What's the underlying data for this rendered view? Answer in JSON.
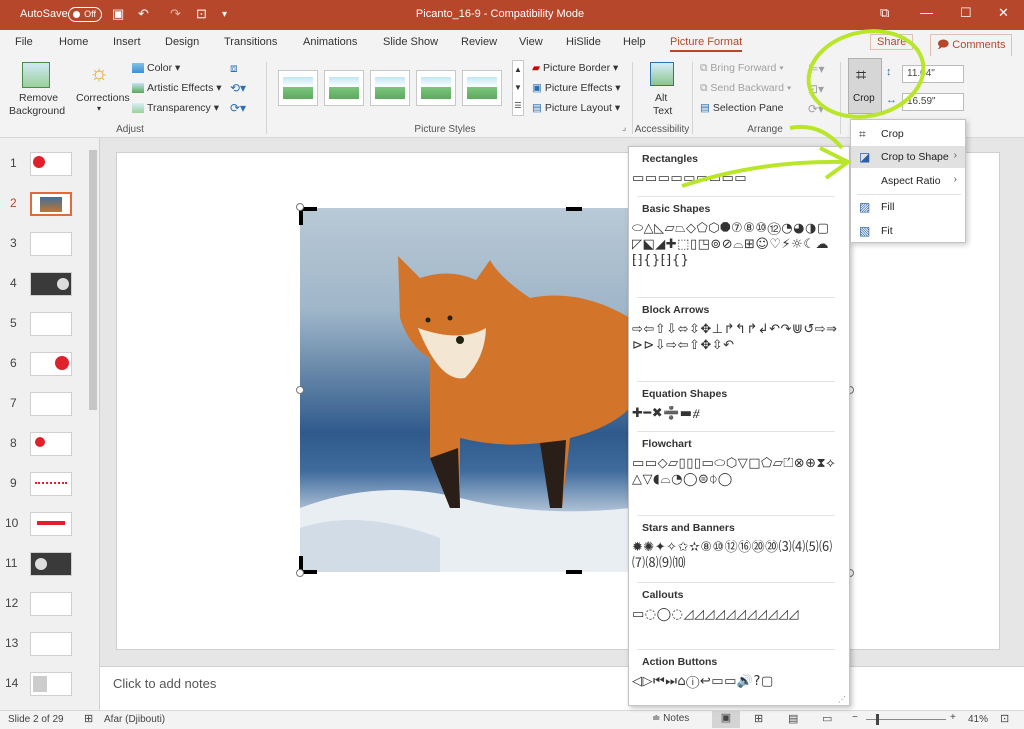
{
  "titlebar": {
    "autosave_label": "AutoSave",
    "autosave_state": "Off",
    "title": "Picanto_16-9  -  Compatibility Mode",
    "icons": [
      "save-icon",
      "undo-icon",
      "redo-icon",
      "present-icon",
      "customize-icon"
    ],
    "window_controls": [
      "restore-icon",
      "minimize-icon",
      "maximize-icon",
      "close-icon"
    ]
  },
  "menu": {
    "items": [
      "File",
      "Home",
      "Insert",
      "Design",
      "Transitions",
      "Animations",
      "Slide Show",
      "Review",
      "View",
      "HiSlide",
      "Help",
      "Picture Format"
    ],
    "active": "Picture Format",
    "share": "Share",
    "comments": "Comments"
  },
  "ribbon": {
    "remove_bg_line1": "Remove",
    "remove_bg_line2": "Background",
    "corrections": "Corrections",
    "color": "Color",
    "artistic_effects": "Artistic Effects",
    "transparency": "Transparency",
    "adjust_label": "Adjust",
    "picture_styles_label": "Picture Styles",
    "picture_border": "Picture Border",
    "picture_effects": "Picture Effects",
    "picture_layout": "Picture Layout",
    "alt_text_line1": "Alt",
    "alt_text_line2": "Text",
    "accessibility_label": "Accessibility",
    "bring_forward": "Bring Forward",
    "send_backward": "Send Backward",
    "selection_pane": "Selection Pane",
    "arrange_label": "Arrange",
    "crop": "Crop",
    "height": "11.04\"",
    "width": "16.59\""
  },
  "slides": {
    "numbers": [
      "1",
      "2",
      "3",
      "4",
      "5",
      "6",
      "7",
      "8",
      "9",
      "10",
      "11",
      "12",
      "13",
      "14"
    ],
    "selected": "2"
  },
  "notes_placeholder": "Click to add notes",
  "status": {
    "slide": "Slide 2 of 29",
    "language": "Afar (Djibouti)",
    "notes": "Notes",
    "zoom": "41%"
  },
  "shapes_gallery": {
    "sections": [
      {
        "title": "Rectangles",
        "glyphs": "▭▭▭▭▭▭▭▭▭"
      },
      {
        "title": "Basic Shapes",
        "glyphs": "⬭△◺▱⏢◇⬠⬡⯃⑦⑧⑩⑫◔◕◑▢◸⬕◢✚⬚▯◳⊚⊘⌓⊞☺♡⚡☼☾☁⁅⁆{}⁅⁆{}"
      },
      {
        "title": "Block Arrows",
        "glyphs": "⇨⇦⇧⇩⬄⇳✥⊥↱↰↱↲↶↷⋓↺⇨⇒⊳⊳⇩⇨⇦⇧✥⇳↶"
      },
      {
        "title": "Equation Shapes",
        "glyphs": "✚━✖➗▬⧣"
      },
      {
        "title": "Flowchart",
        "glyphs": "▭▭◇▱▯▯▯▭⬭⬡▽□⬠▱⏍⊗⊕⧗⟡△▽◖⌓◔◯⊜⏀◯"
      },
      {
        "title": "Stars and Banners",
        "glyphs": "✹✺✦✧✩✫⑧⑩⑫⑯⑳⑳⑶⑷⑸⑹⑺⑻⑼⑽"
      },
      {
        "title": "Callouts",
        "glyphs": "▭◌◯◌◿◿◿◿◿◿◿◿◿◿◿"
      },
      {
        "title": "Action Buttons",
        "glyphs": "◁▷⏮⏭⌂ⓘ↩▭▭🔊?▢"
      }
    ]
  },
  "crop_menu": {
    "items": [
      "Crop",
      "Crop to Shape",
      "Aspect Ratio",
      "Fill",
      "Fit"
    ]
  }
}
